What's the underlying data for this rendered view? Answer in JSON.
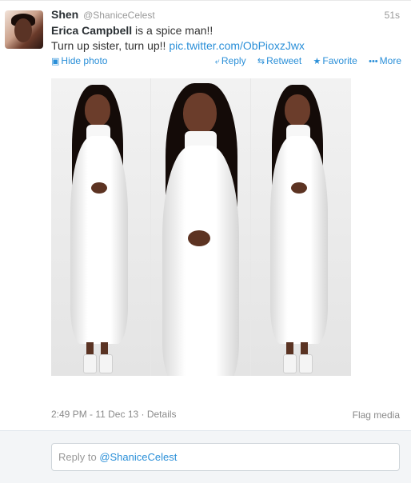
{
  "tweet": {
    "fullname": "Shen",
    "username": "@ShaniceCelest",
    "time": "51s",
    "line1_bold": "Erica Campbell",
    "line1_rest": " is a spice man!!",
    "line2_text": "Turn up sister, turn up!! ",
    "line2_link": "pic.twitter.com/ObPioxzJwx",
    "timestamp": "2:49 PM - 11 Dec 13",
    "separator": " · ",
    "details": "Details",
    "flag_media": "Flag media"
  },
  "actions": {
    "hide_photo": "Hide photo",
    "reply": "Reply",
    "retweet": "Retweet",
    "favorite": "Favorite",
    "more": "More"
  },
  "icons": {
    "hide_photo": "photo-icon",
    "reply": "reply-arrow-icon",
    "retweet": "retweet-icon",
    "favorite": "star-icon",
    "more": "dots-icon"
  },
  "reply": {
    "prefix": "Reply to ",
    "mention": "@ShaniceCelest"
  },
  "colors": {
    "link": "#2a8fd8",
    "muted": "#999999",
    "reply_bg": "#f3f5f7"
  }
}
